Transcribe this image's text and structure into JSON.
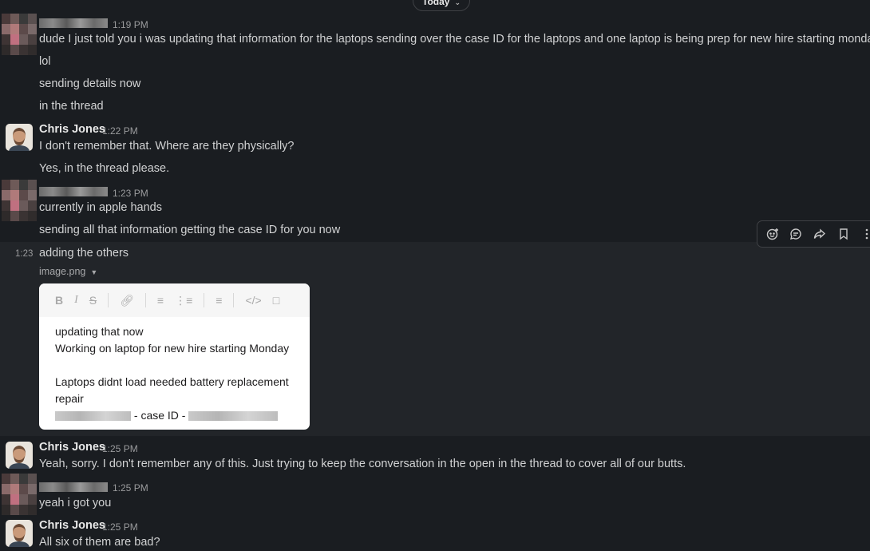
{
  "day_divider": {
    "label": "Today"
  },
  "toolbar": {
    "add_reaction": "add-reaction-icon",
    "reply": "reply-in-thread-icon",
    "forward": "forward-icon",
    "save": "bookmark-icon",
    "more": "more-actions-icon"
  },
  "messages": [
    {
      "time": "1:19 PM",
      "lines": [
        "dude I just told you i was updating that information for the laptops sending over the case ID for the laptops and one laptop is being prep for new hire starting monday",
        "lol",
        "sending details now",
        "in the thread"
      ]
    },
    {
      "sender": "Chris Jones",
      "time": "1:22 PM",
      "lines": [
        "I don't remember that. Where are they physically?",
        "Yes, in the thread please."
      ]
    },
    {
      "time": "1:23 PM",
      "lines": [
        "currently in apple hands",
        "sending all that information getting the case ID for you now"
      ]
    },
    {
      "short_time": "1:23",
      "line": "adding the others",
      "attachment": {
        "file_name": "image.png",
        "preview_lines": [
          "updating that now",
          "Working on laptop for new hire starting Monday",
          "Laptops didnt load needed battery replacement",
          "repair",
          "- case ID -"
        ]
      }
    },
    {
      "sender": "Chris Jones",
      "time": "1:25 PM",
      "lines": [
        "Yeah, sorry. I don't remember any of this. Just trying to keep the conversation in the open in the thread to cover all of our butts."
      ]
    },
    {
      "time": "1:25 PM",
      "lines": [
        "yeah i got you"
      ]
    },
    {
      "sender": "Chris Jones",
      "time": "1:25 PM",
      "lines": [
        "All six of them are bad?"
      ]
    }
  ]
}
